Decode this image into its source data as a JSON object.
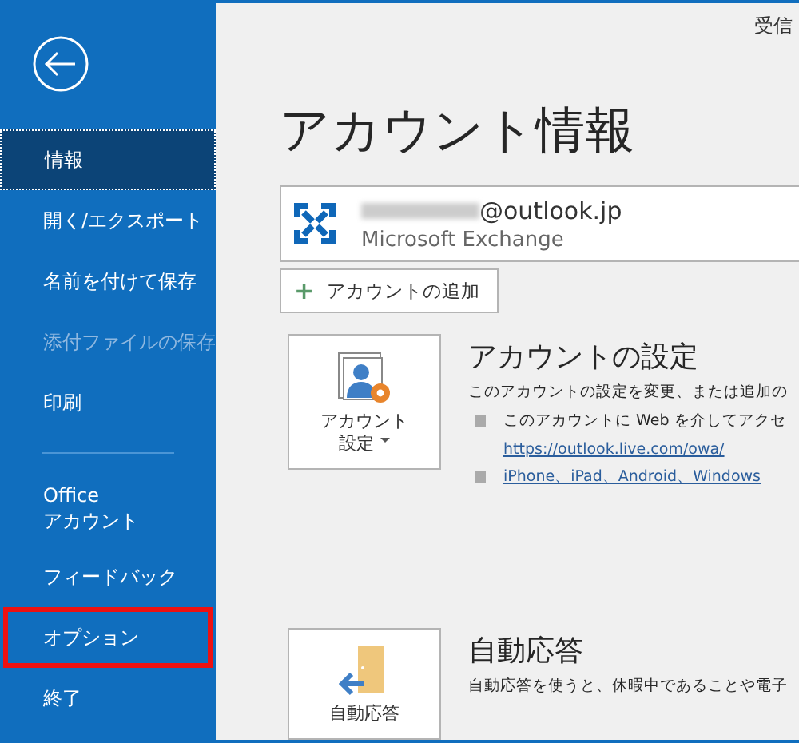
{
  "sidebar": {
    "items": [
      {
        "label": "情報",
        "selected": true,
        "disabled": false,
        "highlighted": false
      },
      {
        "label": "開く/エクスポート",
        "selected": false,
        "disabled": false,
        "highlighted": false
      },
      {
        "label": "名前を付けて保存",
        "selected": false,
        "disabled": false,
        "highlighted": false
      },
      {
        "label": "添付ファイルの保存",
        "selected": false,
        "disabled": true,
        "highlighted": false
      },
      {
        "label": "印刷",
        "selected": false,
        "disabled": false,
        "highlighted": false
      },
      {
        "label": "Office\nアカウント",
        "selected": false,
        "disabled": false,
        "highlighted": false,
        "divider_before": true
      },
      {
        "label": "フィードバック",
        "selected": false,
        "disabled": false,
        "highlighted": false
      },
      {
        "label": "オプション",
        "selected": false,
        "disabled": false,
        "highlighted": true
      },
      {
        "label": "終了",
        "selected": false,
        "disabled": false,
        "highlighted": false
      }
    ]
  },
  "top_right_text": "受信",
  "page_title": "アカウント情報",
  "account": {
    "email": "@outlook.jp",
    "type": "Microsoft Exchange"
  },
  "add_account_button": {
    "icon": "+",
    "label": "アカウントの追加"
  },
  "sections": [
    {
      "kind": "settings",
      "tile_label": [
        "アカウント",
        "設定"
      ],
      "heading": "アカウントの設定",
      "description": "このアカウントの設定を変更、または追加の",
      "bullets": [
        {
          "lines": [
            {
              "text": "このアカウントに Web を介してアクセ",
              "link": false
            },
            {
              "text": "https://outlook.live.com/owa/",
              "link": true
            }
          ]
        },
        {
          "lines": [
            {
              "text": "iPhone、iPad、Android、Windows",
              "link": true
            }
          ]
        }
      ]
    },
    {
      "kind": "autoreply",
      "tile_label": [
        "自動応答"
      ],
      "heading": "自動応答",
      "description": "自動応答を使うと、休暇中であることや電子"
    }
  ]
}
